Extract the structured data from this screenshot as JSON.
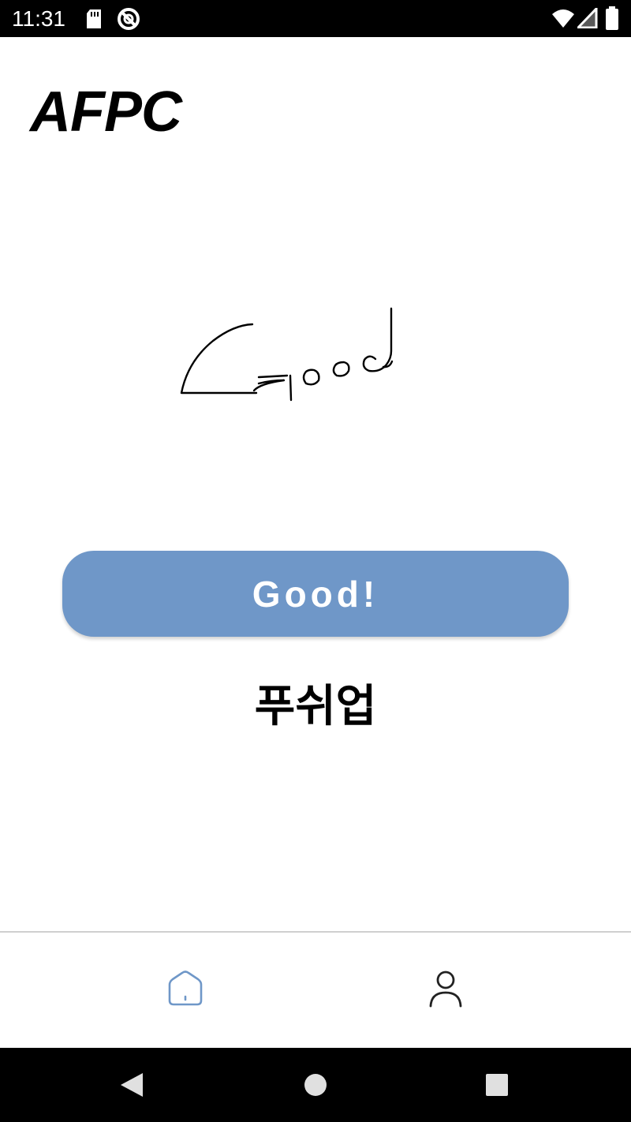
{
  "status_bar": {
    "time": "11:31",
    "left_icons": [
      "sd-card-icon",
      "no-disturb-icon"
    ],
    "right_icons": [
      "wifi-icon",
      "signal-icon",
      "battery-icon"
    ]
  },
  "app": {
    "title": "AFPC"
  },
  "canvas": {
    "content": "handwritten drawing"
  },
  "main": {
    "button_label": "Good!",
    "result_text": "푸쉬업"
  },
  "bottom_nav": {
    "items": [
      {
        "icon": "home-icon",
        "active": true
      },
      {
        "icon": "profile-icon",
        "active": false
      }
    ],
    "active_color": "#6f97c8",
    "inactive_color": "#222222"
  },
  "colors": {
    "accent": "#6f97c8",
    "text": "#000000",
    "background": "#ffffff"
  },
  "system_nav": {
    "buttons": [
      "back-icon",
      "home-circle-icon",
      "recents-icon"
    ]
  }
}
